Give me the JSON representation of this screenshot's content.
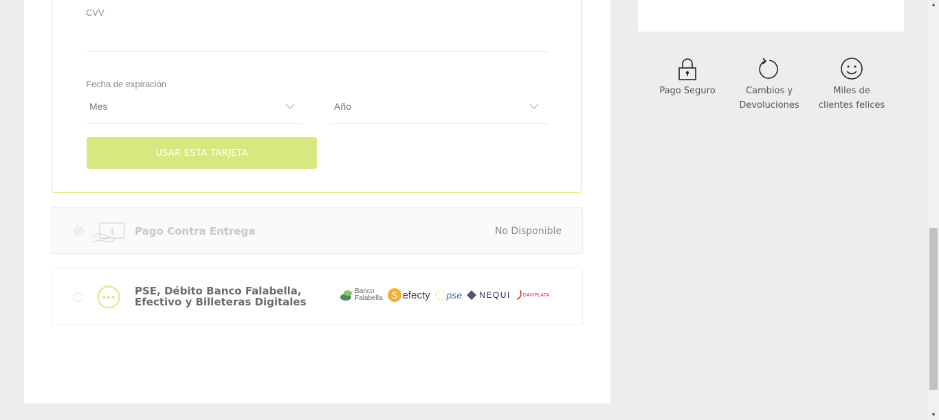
{
  "form": {
    "cvv_label": "CVV",
    "expiry_label": "Fecha de expiración",
    "month_placeholder": "Mes",
    "year_placeholder": "Año",
    "use_card_label": "USAR ESTA TARJETA"
  },
  "options": {
    "cod": {
      "title": "Pago Contra Entrega",
      "status": "No Disponible"
    },
    "pse": {
      "title_line1": "PSE, Débito Banco Falabella,",
      "title_line2": "Efectivo y Billeteras Digitales",
      "brands": {
        "falabella_line1": "Banco",
        "falabella_line2": "Falabella",
        "efecty": "efecty",
        "pse": "pse",
        "nequi": "NEQUI",
        "daviplata": "DAVIPLATA"
      }
    }
  },
  "features": {
    "secure": "Pago Seguro",
    "returns_line1": "Cambios y",
    "returns_line2": "Devoluciones",
    "clients_line1": "Miles de",
    "clients_line2": "clientes felices"
  },
  "colors": {
    "accent": "#d6e981",
    "border_accent": "#dfe88a",
    "falabella_green": "#6aa84f",
    "efecty_gold": "#f2b134",
    "pse_blue": "#3a6fb0",
    "nequi_purple": "#2d1b4e",
    "daviplata_red": "#d9262c"
  }
}
